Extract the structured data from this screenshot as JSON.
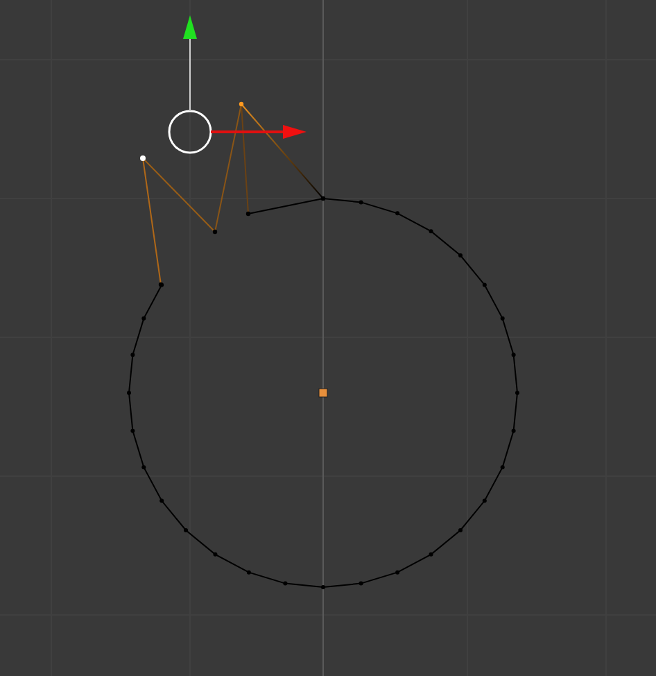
{
  "viewport": {
    "show_grid": true,
    "show_gizmo": true,
    "show_origin": true
  }
}
